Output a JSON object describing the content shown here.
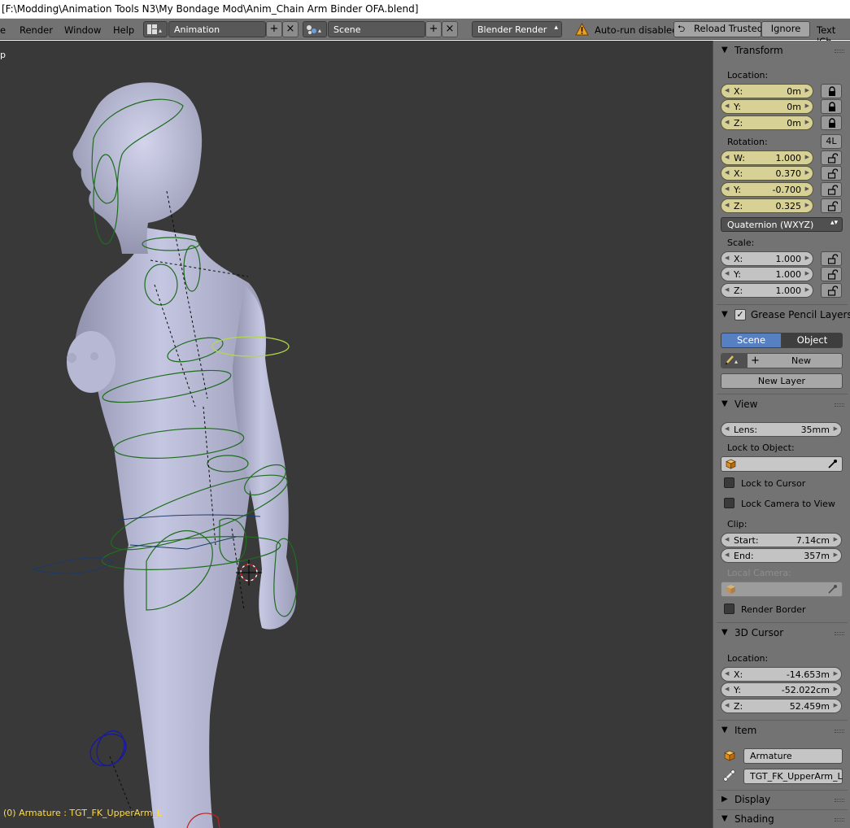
{
  "window": {
    "title": "[F:\\Modding\\Animation Tools N3\\My Bondage Mod\\Anim_Chain Arm Binder OFA.blend]"
  },
  "header": {
    "menus": [
      "Render",
      "Window",
      "Help"
    ],
    "screen_layout": "Animation",
    "scene": "Scene",
    "render_engine": "Blender Render",
    "autorun_warning": "Auto-run disabled",
    "reload_trusted": "Reload Trusted",
    "ignore": "Ignore",
    "text_cut": "Text 'Ch"
  },
  "viewport": {
    "label": "p",
    "status": "(0) Armature : TGT_FK_UpperArm_L",
    "mesh_color": "#b9bbd8",
    "bone_color": "#1f6d1f",
    "selected_bone_color": "#b4d84a",
    "bg_color": "#393939"
  },
  "panel": {
    "transform": {
      "title": "Transform",
      "location_label": "Location:",
      "location": [
        {
          "axis": "X:",
          "value": "0m"
        },
        {
          "axis": "Y:",
          "value": "0m"
        },
        {
          "axis": "Z:",
          "value": "0m"
        }
      ],
      "rotation_label": "Rotation:",
      "rotation_lock_mode": "4L",
      "rotation": [
        {
          "axis": "W:",
          "value": "1.000"
        },
        {
          "axis": "X:",
          "value": "0.370"
        },
        {
          "axis": "Y:",
          "value": "-0.700"
        },
        {
          "axis": "Z:",
          "value": "0.325"
        }
      ],
      "rotation_mode": "Quaternion (WXYZ)",
      "scale_label": "Scale:",
      "scale": [
        {
          "axis": "X:",
          "value": "1.000"
        },
        {
          "axis": "Y:",
          "value": "1.000"
        },
        {
          "axis": "Z:",
          "value": "1.000"
        }
      ]
    },
    "grease_pencil": {
      "title": "Grease Pencil Layers",
      "tabs": [
        "Scene",
        "Object"
      ],
      "new": "New",
      "new_layer": "New Layer"
    },
    "view": {
      "title": "View",
      "lens_label": "Lens:",
      "lens": "35mm",
      "lock_to_object": "Lock to Object:",
      "lock_to_cursor": "Lock to Cursor",
      "lock_camera_to_view": "Lock Camera to View",
      "clip_label": "Clip:",
      "clip_start_label": "Start:",
      "clip_start": "7.14cm",
      "clip_end_label": "End:",
      "clip_end": "357m",
      "local_camera": "Local Camera:",
      "render_border": "Render Border"
    },
    "cursor": {
      "title": "3D Cursor",
      "location_label": "Location:",
      "location": [
        {
          "axis": "X:",
          "value": "-14.653m"
        },
        {
          "axis": "Y:",
          "value": "-52.022cm"
        },
        {
          "axis": "Z:",
          "value": "52.459m"
        }
      ]
    },
    "item": {
      "title": "Item",
      "object": "Armature",
      "bone": "TGT_FK_UpperArm_L"
    },
    "display": {
      "title": "Display"
    },
    "shading": {
      "title": "Shading"
    }
  }
}
